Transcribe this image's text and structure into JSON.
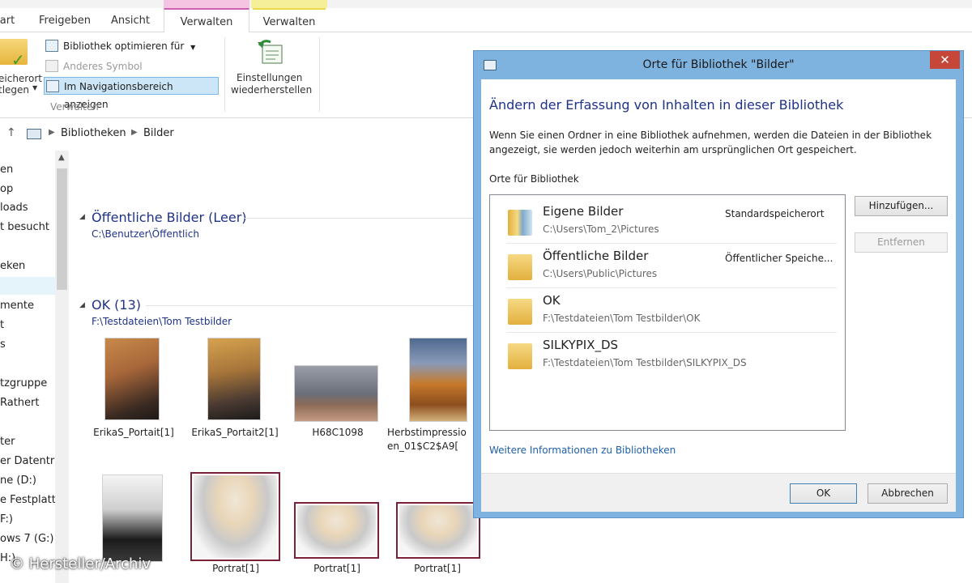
{
  "ribbon": {
    "tabs": [
      {
        "label": "art"
      },
      {
        "label": "Freigeben"
      },
      {
        "label": "Ansicht"
      },
      {
        "label": "Verwalten"
      },
      {
        "label": "Verwalten"
      }
    ],
    "save_location_label_1": "eicherort",
    "save_location_label_2": "tlegen",
    "optimize_label": "Bibliothek optimieren für",
    "other_icon_label": "Anderes Symbol",
    "show_nav_label": "Im Navigationsbereich anzeigen",
    "group_label": "Verwalten",
    "restore_label_1": "Einstellungen",
    "restore_label_2": "wiederherstellen"
  },
  "address": {
    "crumbs": [
      "Bibliotheken",
      "Bilder"
    ]
  },
  "nav": {
    "items": [
      "en",
      "op",
      "loads",
      "t besucht",
      "eken",
      "mente",
      "t",
      "s",
      "tzgruppe",
      "Rathert",
      "ter",
      "er Datenträg",
      "ne (D:)",
      "e Festplatte",
      "F:)",
      "ows 7 (G:)",
      "H:)"
    ]
  },
  "content": {
    "group1": {
      "title": "Öffentliche Bilder (Leer)",
      "path": "C:\\Benutzer\\Öffentlich"
    },
    "group2": {
      "title": "OK (13)",
      "path": "F:\\Testdateien\\Tom Testbilder"
    },
    "thumbs": [
      {
        "caption": "ErikaS_Portait[1]"
      },
      {
        "caption": "ErikaS_Portait2[1]"
      },
      {
        "caption": "H68C1098"
      },
      {
        "caption": "Herbstimpressio",
        "caption2": "en_01$C2$A9["
      },
      {
        "caption": ""
      },
      {
        "caption": "Portrat[1]"
      },
      {
        "caption": "Portrat[1]"
      },
      {
        "caption": "Portrat[1]"
      }
    ]
  },
  "dialog": {
    "title": "Orte für Bibliothek \"Bilder\"",
    "heading": "Ändern der Erfassung von Inhalten in dieser Bibliothek",
    "description": "Wenn Sie einen Ordner in eine Bibliothek aufnehmen, werden die Dateien in der Bibliothek angezeigt, sie werden jedoch weiterhin am ursprünglichen Ort gespeichert.",
    "list_label": "Orte für Bibliothek",
    "locations": [
      {
        "name": "Eigene Bilder",
        "path": "C:\\Users\\Tom_2\\Pictures",
        "status": "Standardspeicherort"
      },
      {
        "name": "Öffentliche Bilder",
        "path": "C:\\Users\\Public\\Pictures",
        "status": "Öffentlicher Speiche..."
      },
      {
        "name": "OK",
        "path": "F:\\Testdateien\\Tom Testbilder\\OK",
        "status": ""
      },
      {
        "name": "SILKYPIX_DS",
        "path": "F:\\Testdateien\\Tom Testbilder\\SILKYPIX_DS",
        "status": ""
      }
    ],
    "add_button": "Hinzufügen...",
    "remove_button": "Entfernen",
    "more_info_link": "Weitere Informationen zu Bibliotheken",
    "ok_button": "OK",
    "cancel_button": "Abbrechen",
    "close_glyph": "✕"
  },
  "watermark": "© Hersteller/Archiv"
}
